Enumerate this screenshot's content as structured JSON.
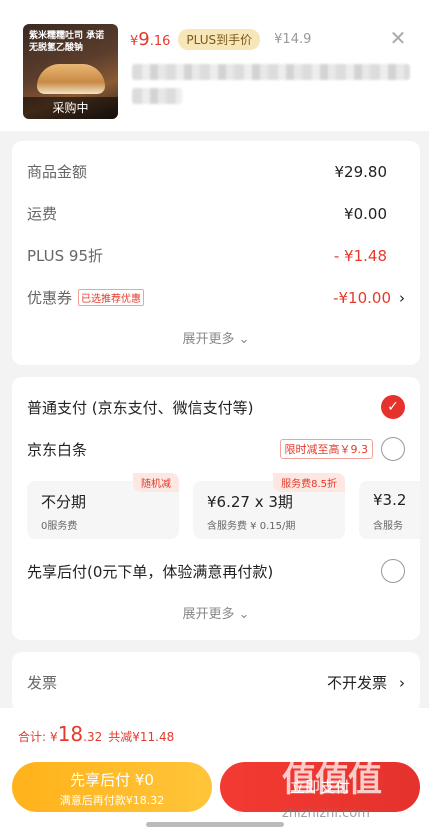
{
  "product": {
    "thumbnail_text": "紫米糯糯吐司 承诺无脱氢乙酸钠",
    "status": "采购中",
    "price_symbol": "¥",
    "price_int": "9",
    "price_dec": ".16",
    "plus_badge": "PLUS到手价",
    "original_price": "¥14.9",
    "close_icon": "close-icon"
  },
  "summary": {
    "rows": [
      {
        "label": "商品金额",
        "value": "¥29.80"
      },
      {
        "label": "运费",
        "value": "¥0.00"
      },
      {
        "label": "PLUS 95折",
        "value": "- ¥1.48"
      },
      {
        "label": "优惠券",
        "tag": "已选推荐优惠",
        "value": "-¥10.00"
      }
    ],
    "expand": "展开更多"
  },
  "payment": {
    "normal": "普通支付 (京东支付、微信支付等)",
    "baitiao": "京东白条",
    "baitiao_promo": "限时减至高￥9.3",
    "plans": [
      {
        "tag": "随机减",
        "main": "不分期",
        "sub": "0服务费"
      },
      {
        "tag": "服务费8.5折",
        "main": "¥6.27 x 3期",
        "sub": "含服务费 ¥ 0.15/期"
      },
      {
        "tag": "",
        "main": "¥3.2",
        "sub": "含服务"
      }
    ],
    "pay_later": "先享后付(0元下单，体验满意再付款)",
    "expand": "展开更多"
  },
  "invoice": {
    "label": "发票",
    "value": "不开发票"
  },
  "footer": {
    "total_label": "合计:",
    "total_symbol": "¥",
    "total_int": "18",
    "total_dec": ".32",
    "saved": "共减¥11.48",
    "later_title": "先享后付 ¥0",
    "later_sub": "满意后再付款¥18.32",
    "pay_button": "立即支付"
  },
  "watermark": {
    "text": "值值值",
    "url": "zhizhizhi.com"
  },
  "colors": {
    "accent_red": "#e53a2b",
    "gold": "#ffb21b"
  }
}
